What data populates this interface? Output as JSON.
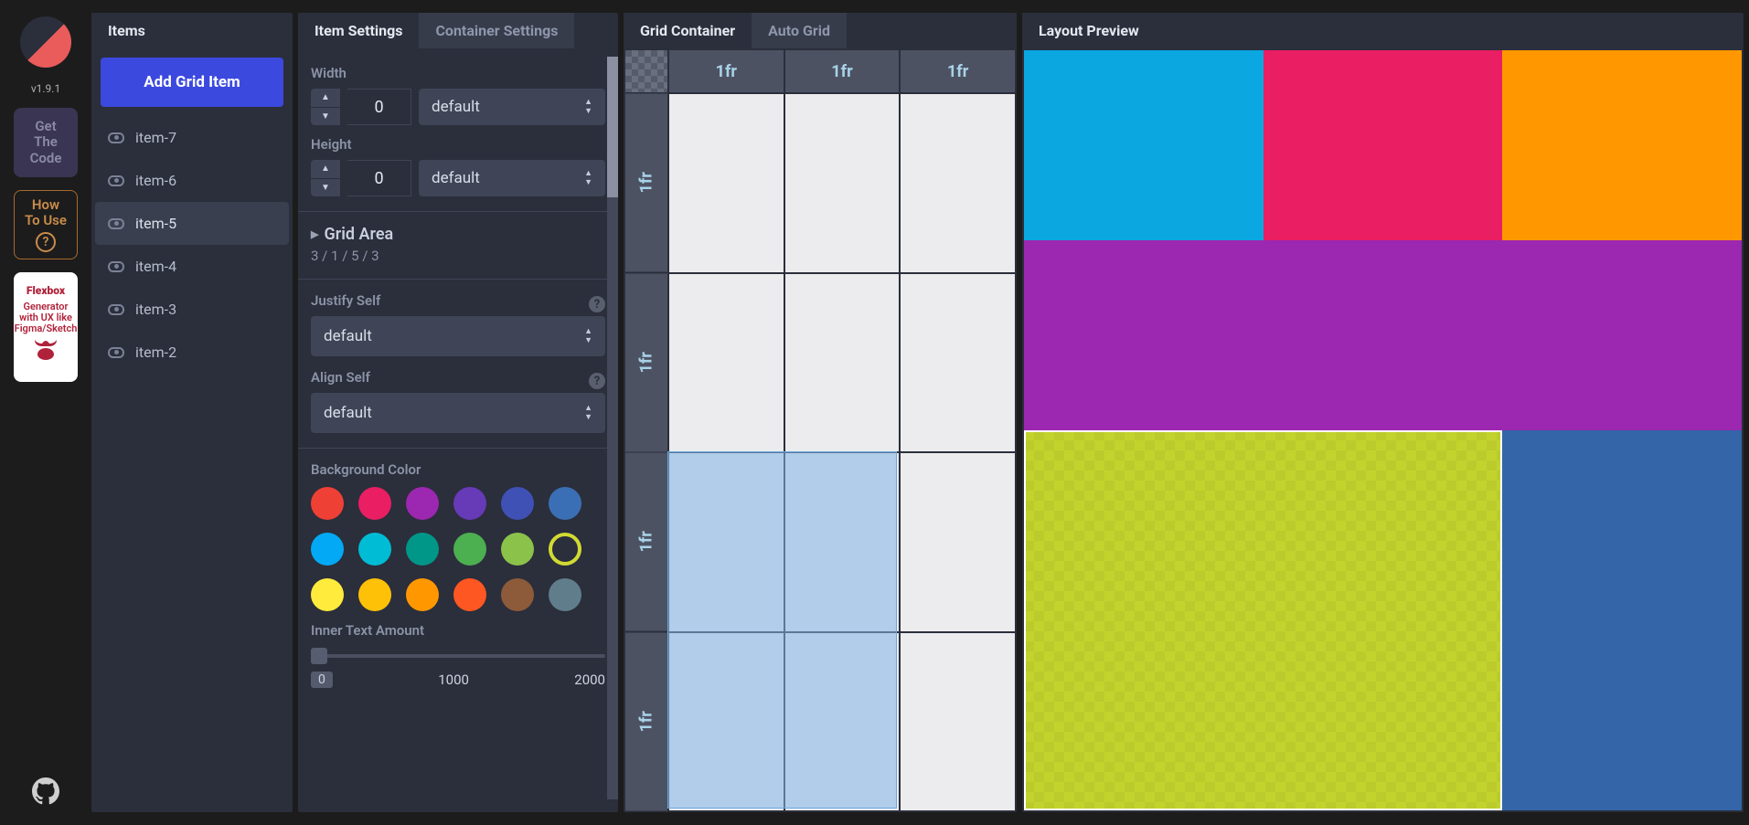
{
  "version": "v1.9.1",
  "rail": {
    "get_code": "Get\nThe\nCode",
    "how_to": "How\nTo Use",
    "flexbox": "Flexbox",
    "flexbox_sub": "Generator with UX like Figma/Sketch"
  },
  "items_panel": {
    "tab": "Items",
    "add_btn": "Add Grid Item",
    "items": [
      {
        "name": "item-7",
        "selected": false
      },
      {
        "name": "item-6",
        "selected": false
      },
      {
        "name": "item-5",
        "selected": true
      },
      {
        "name": "item-4",
        "selected": false
      },
      {
        "name": "item-3",
        "selected": false
      },
      {
        "name": "item-2",
        "selected": false
      }
    ]
  },
  "settings_panel": {
    "tabs": {
      "item": "Item Settings",
      "container": "Container Settings"
    },
    "active_tab": "item",
    "width": {
      "label": "Width",
      "value": "0",
      "unit": "default"
    },
    "height": {
      "label": "Height",
      "value": "0",
      "unit": "default"
    },
    "grid_area": {
      "label": "Grid Area",
      "value": "3 / 1 / 5 / 3"
    },
    "justify_self": {
      "label": "Justify Self",
      "value": "default"
    },
    "align_self": {
      "label": "Align Self",
      "value": "default"
    },
    "bg_label": "Background Color",
    "swatches": [
      "#ee4035",
      "#e91e63",
      "#9c27b0",
      "#673ab7",
      "#3f51b5",
      "#3b6fb5",
      "#03a9f4",
      "#00bcd4",
      "#009688",
      "#4caf50",
      "#8bc34a",
      "RING",
      "#ffeb3b",
      "#ffc107",
      "#ff9800",
      "#ff5722",
      "#8d5b3a",
      "#607d8b"
    ],
    "inner_text": {
      "label": "Inner Text Amount",
      "value": "0",
      "mid": "1000",
      "max": "2000"
    }
  },
  "grid_panel": {
    "tabs": {
      "container": "Grid Container",
      "auto": "Auto Grid"
    },
    "active_tab": "container",
    "cols": [
      "1fr",
      "1fr",
      "1fr"
    ],
    "rows": [
      "1fr",
      "1fr",
      "1fr",
      "1fr"
    ],
    "selection": {
      "row_start": 3,
      "col_start": 1,
      "row_end": 5,
      "col_end": 3
    }
  },
  "preview_panel": {
    "tab": "Layout Preview",
    "cells": [
      {
        "area": "1/1/2/2",
        "color": "#0aa7e0"
      },
      {
        "area": "1/2/2/3",
        "color": "#e91e63"
      },
      {
        "area": "1/3/2/4",
        "color": "#ff9800"
      },
      {
        "area": "2/1/3/4",
        "color": "#9c27b0"
      },
      {
        "area": "3/1/5/3",
        "color": "#c3d32e",
        "outlined": true
      },
      {
        "area": "3/3/5/4",
        "color": "#3365a8"
      }
    ]
  }
}
